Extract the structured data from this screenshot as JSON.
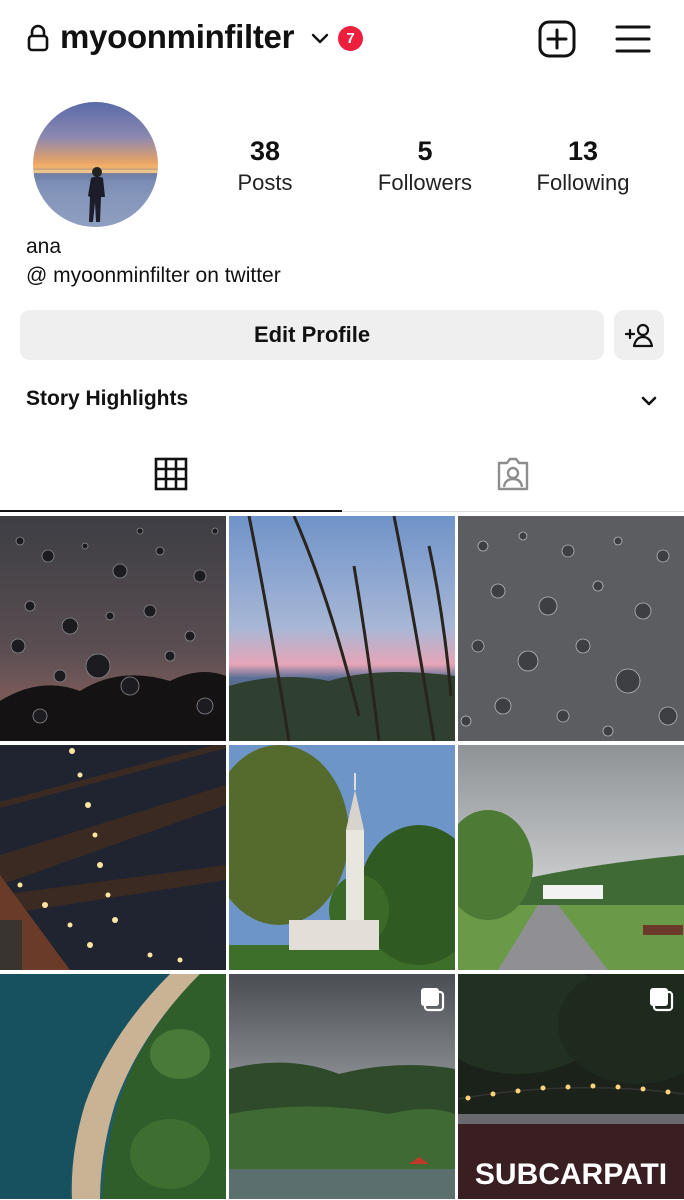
{
  "header": {
    "username": "myoonminfilter",
    "notification_count": "7"
  },
  "profile": {
    "stats": [
      {
        "value": "38",
        "label": "Posts"
      },
      {
        "value": "5",
        "label": "Followers"
      },
      {
        "value": "13",
        "label": "Following"
      }
    ],
    "display_name": "ana",
    "bio": "@ myoonminfilter on twitter",
    "edit_button_label": "Edit Profile",
    "highlights_label": "Story Highlights"
  },
  "colors": {
    "badge": "#ec1f3c",
    "button_bg": "#efefef",
    "text": "#111111",
    "divider": "#dbdbdb"
  },
  "tabs": [
    {
      "icon": "grid-icon",
      "active": true
    },
    {
      "icon": "tagged-person-icon",
      "active": false
    }
  ],
  "posts": [
    {
      "subject": "raindrops-dusk",
      "multiple": false
    },
    {
      "subject": "grass-sunset",
      "multiple": false
    },
    {
      "subject": "raindrops-grey",
      "multiple": false
    },
    {
      "subject": "string-lights-ceiling",
      "multiple": false
    },
    {
      "subject": "church-trees",
      "multiple": false
    },
    {
      "subject": "park-path-cloudy",
      "multiple": false
    },
    {
      "subject": "aerial-coast",
      "multiple": false
    },
    {
      "subject": "lake-hills-storm",
      "multiple": true
    },
    {
      "subject": "subcarpati-stage",
      "multiple": true,
      "sign_text": "SUBCARPATI"
    }
  ]
}
